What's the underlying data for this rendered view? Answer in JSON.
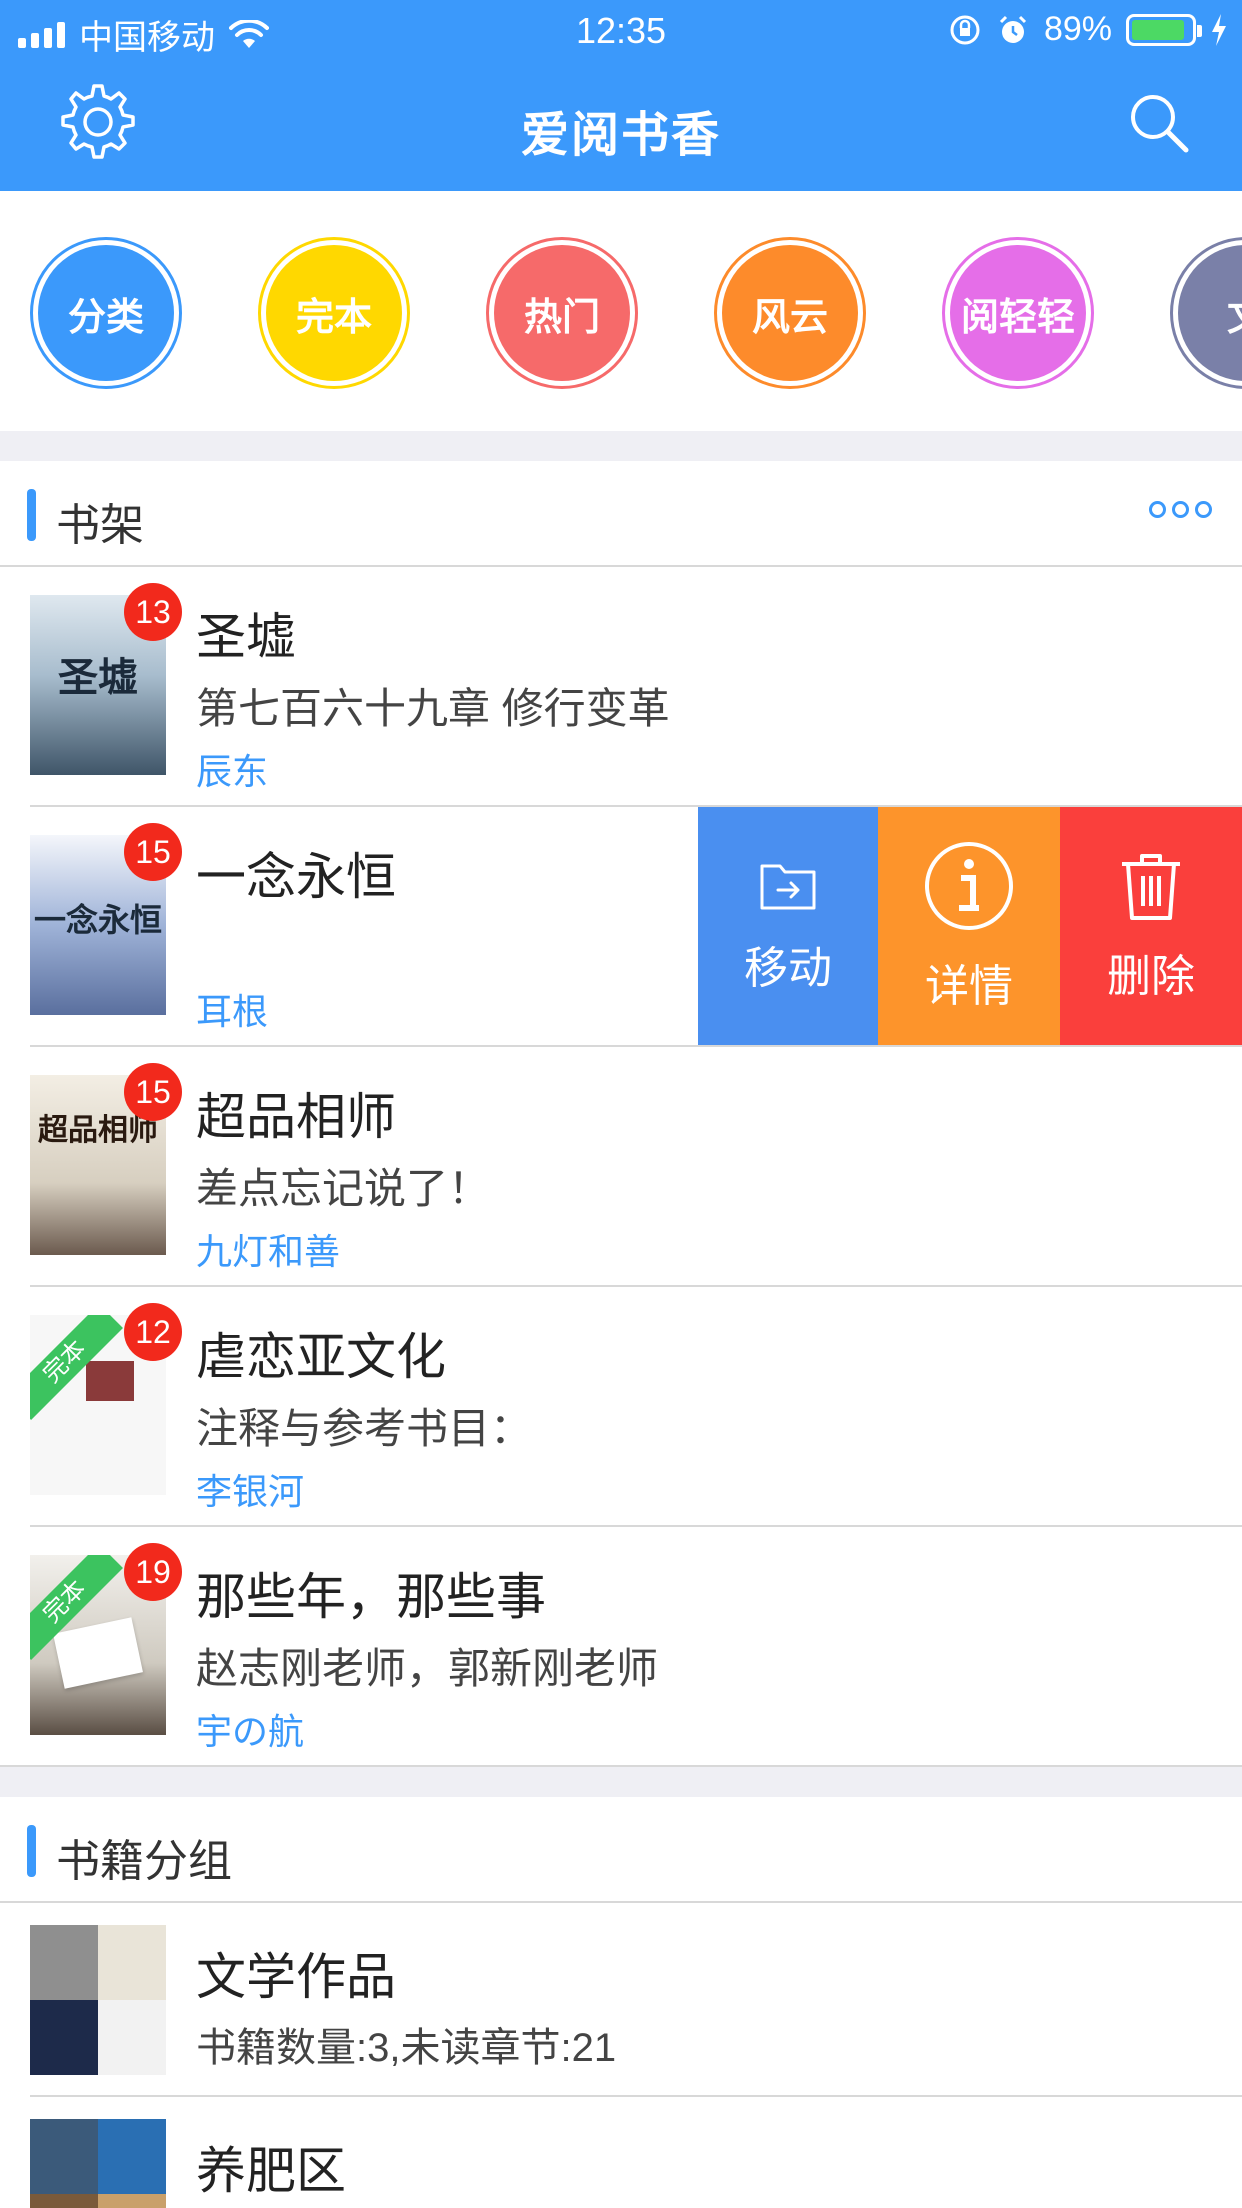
{
  "status": {
    "carrier": "中国移动",
    "time": "12:35",
    "battery": "89%",
    "battery_level": 0.89
  },
  "nav": {
    "title": "爱阅书香",
    "left_icon": "gear-icon",
    "right_icon": "search-icon"
  },
  "categories": [
    {
      "label": "分类",
      "color": "#3b99fb"
    },
    {
      "label": "完本",
      "color": "#ffd800"
    },
    {
      "label": "热门",
      "color": "#f66a6a"
    },
    {
      "label": "风云",
      "color": "#fd8b2b"
    },
    {
      "label": "阅轻轻",
      "color": "#e56ee8"
    },
    {
      "label": "文",
      "color": "#7a80a8"
    }
  ],
  "bookshelf": {
    "title": "书架",
    "books": [
      {
        "title": "圣墟",
        "chapter": "第七百六十九章 修行变革",
        "author": "辰东",
        "badge": "13",
        "cover_text": "圣墟",
        "ribbon": ""
      },
      {
        "title": "一念永恒",
        "chapter": "",
        "author": "耳根",
        "badge": "15",
        "cover_text": "一念永恒",
        "ribbon": ""
      },
      {
        "title": "超品相师",
        "chapter": "差点忘记说了！",
        "author": "九灯和善",
        "badge": "15",
        "cover_text": "超品相师",
        "ribbon": ""
      },
      {
        "title": "虐恋亚文化",
        "chapter": "注释与参考书目：",
        "author": "李银河",
        "badge": "12",
        "cover_text": "",
        "ribbon": "完本"
      },
      {
        "title": "那些年，那些事",
        "chapter": "赵志刚老师，郭新刚老师",
        "author": "宇の航",
        "badge": "19",
        "cover_text": "",
        "ribbon": "完本"
      }
    ],
    "swipe_actions": {
      "move": "移动",
      "detail": "详情",
      "delete": "删除"
    }
  },
  "groups": {
    "title": "书籍分组",
    "items": [
      {
        "title": "文学作品",
        "subtitle": "书籍数量:3,未读章节:21"
      },
      {
        "title": "养肥区",
        "subtitle": ""
      }
    ]
  }
}
